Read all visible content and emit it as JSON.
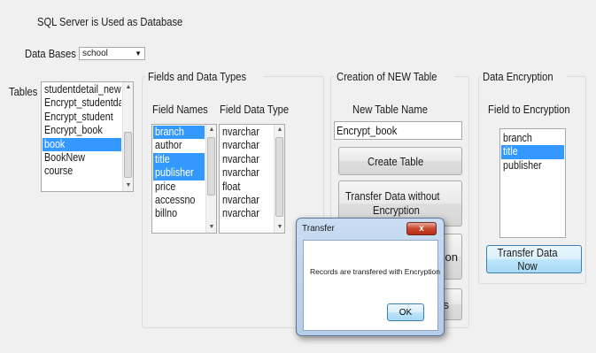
{
  "header": {
    "title": "SQL Server is Used as Database"
  },
  "databases": {
    "label": "Data Bases",
    "selected": "school"
  },
  "tables": {
    "label": "Tables",
    "items": [
      {
        "text": "studentdetail_new",
        "selected": false
      },
      {
        "text": "Encrypt_studentdata",
        "selected": false
      },
      {
        "text": "Encrypt_student",
        "selected": false
      },
      {
        "text": "Encrypt_book",
        "selected": false
      },
      {
        "text": "book",
        "selected": true
      },
      {
        "text": "BookNew",
        "selected": false
      },
      {
        "text": "course",
        "selected": false
      }
    ]
  },
  "fields_group": {
    "title": "Fields and Data Types",
    "names_label": "Field Names",
    "types_label": "Field Data Type",
    "names": [
      {
        "text": "branch",
        "selected": true
      },
      {
        "text": "author",
        "selected": false
      },
      {
        "text": "title",
        "selected": true
      },
      {
        "text": "publisher",
        "selected": true
      },
      {
        "text": "price",
        "selected": false
      },
      {
        "text": "accessno",
        "selected": false
      },
      {
        "text": "billno",
        "selected": false
      }
    ],
    "types": [
      "nvarchar",
      "nvarchar",
      "nvarchar",
      "nvarchar",
      "float",
      "nvarchar",
      "nvarchar"
    ]
  },
  "new_table_group": {
    "title": "Creation of NEW Table",
    "name_label": "New Table Name",
    "name_value": "Encrypt_book",
    "create_button": "Create Table",
    "transfer_plain_line1": "Transfer Data without",
    "transfer_plain_line2": "Encryption",
    "hidden_btn1_tail": "ption",
    "hidden_btn2_tail": "s"
  },
  "encryption_group": {
    "title": "Data Encryption",
    "field_label": "Field to Encryption",
    "fields": [
      {
        "text": "branch",
        "selected": false
      },
      {
        "text": "title",
        "selected": true
      },
      {
        "text": "publisher",
        "selected": false
      }
    ],
    "transfer_button": "Transfer Data Now"
  },
  "dialog": {
    "title": "Transfer",
    "close": "x",
    "message": "Records are transfered with Encryption",
    "ok": "OK"
  },
  "colors": {
    "selection": "#3399ff",
    "background": "#f0f0f0"
  }
}
